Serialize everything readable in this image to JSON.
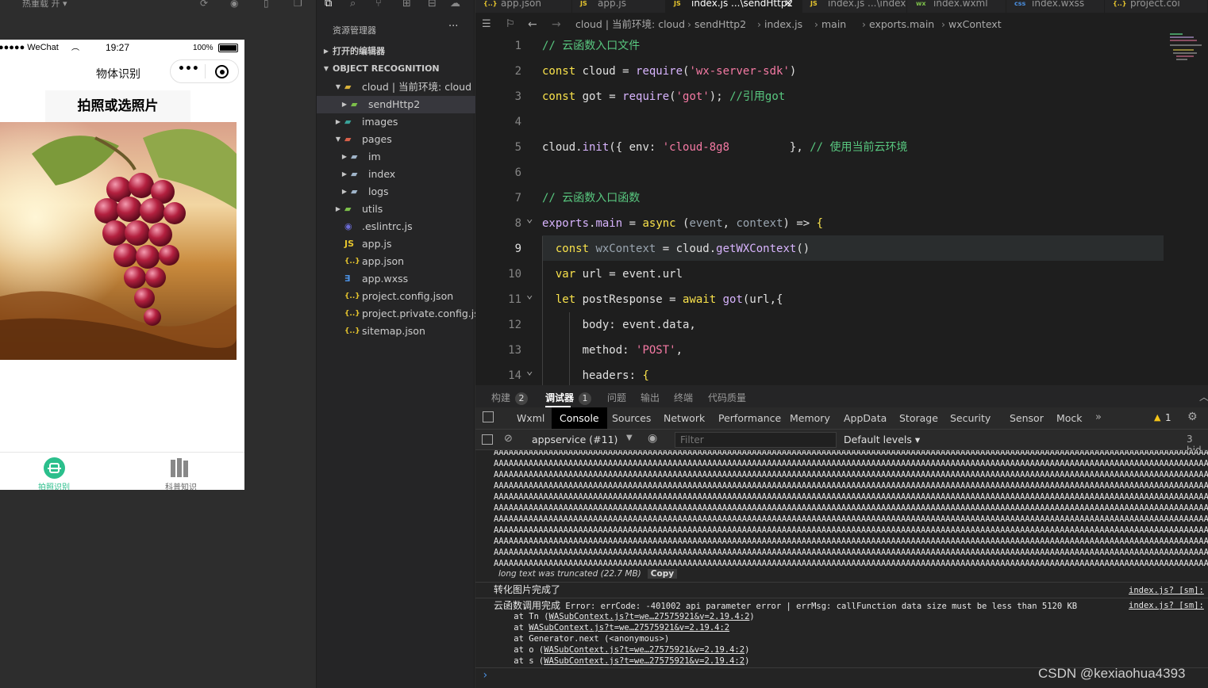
{
  "sim_topbar": {
    "label": "热重载 开 ▾"
  },
  "phone": {
    "status": {
      "carrier": "●●●●● WeChat",
      "time": "19:27",
      "battery": "100%"
    },
    "nav_title": "物体识别",
    "capsule_more": "•••",
    "photo_button": "拍照或选照片",
    "tabbar": [
      {
        "label": "拍照识别",
        "active": true
      },
      {
        "label": "科普知识",
        "active": false
      }
    ],
    "accent_color": "#2bbf8c"
  },
  "explorer": {
    "title": "资源管理器",
    "more": "···",
    "open_editors": "打开的编辑器",
    "project": "OBJECT RECOGNITION",
    "tree": [
      {
        "label": "cloud | 当前环境: cloud",
        "level": 1,
        "expanded": true,
        "type": "folder-cloud"
      },
      {
        "label": "sendHttp2",
        "level": 2,
        "expanded": false,
        "type": "folder-green",
        "selected": true
      },
      {
        "label": "images",
        "level": 1,
        "expanded": false,
        "type": "folder-teal"
      },
      {
        "label": "pages",
        "level": 1,
        "expanded": true,
        "type": "folder-red"
      },
      {
        "label": "im",
        "level": 2,
        "expanded": false,
        "type": "folder-plain"
      },
      {
        "label": "index",
        "level": 2,
        "expanded": false,
        "type": "folder-plain"
      },
      {
        "label": "logs",
        "level": 2,
        "expanded": false,
        "type": "folder-plain"
      },
      {
        "label": "utils",
        "level": 1,
        "expanded": false,
        "type": "folder-green"
      },
      {
        "label": ".eslintrc.js",
        "level": 1,
        "type": "file-eslint"
      },
      {
        "label": "app.js",
        "level": 1,
        "type": "file-js"
      },
      {
        "label": "app.json",
        "level": 1,
        "type": "file-json"
      },
      {
        "label": "app.wxss",
        "level": 1,
        "type": "file-css"
      },
      {
        "label": "project.config.json",
        "level": 1,
        "type": "file-json"
      },
      {
        "label": "project.private.config.js...",
        "level": 1,
        "type": "file-json"
      },
      {
        "label": "sitemap.json",
        "level": 1,
        "type": "file-json"
      }
    ]
  },
  "tabs": [
    {
      "label": "app.json",
      "icon": "{..}",
      "active": false
    },
    {
      "label": "app.js",
      "icon": "JS",
      "active": false
    },
    {
      "label": "index.js ...\\sendHttp2",
      "icon": "JS",
      "active": true,
      "close": "✕"
    },
    {
      "label": "index.js ...\\index",
      "icon": "JS",
      "active": false
    },
    {
      "label": "index.wxml",
      "icon": "wx",
      "active": false
    },
    {
      "label": "index.wxss",
      "icon": "css",
      "active": false
    },
    {
      "label": "project.coi",
      "icon": "{..}",
      "active": false
    }
  ],
  "breadcrumb": [
    "cloud | 当前环境: cloud",
    "sendHttp2",
    "index.js",
    "main",
    "exports.main",
    "wxContext"
  ],
  "code_lines": [
    {
      "n": "1",
      "parts": [
        [
          "cmt",
          "// 云函数入口文件"
        ]
      ]
    },
    {
      "n": "2",
      "parts": [
        [
          "kw",
          "const "
        ],
        [
          "plain",
          "cloud "
        ],
        [
          "plain",
          "= "
        ],
        [
          "fn",
          "require"
        ],
        [
          "plain",
          "("
        ],
        [
          "str",
          "'wx-server-sdk'"
        ],
        [
          "plain",
          ")"
        ]
      ]
    },
    {
      "n": "3",
      "parts": [
        [
          "kw",
          "const "
        ],
        [
          "plain",
          "got "
        ],
        [
          "plain",
          "= "
        ],
        [
          "fn",
          "require"
        ],
        [
          "plain",
          "("
        ],
        [
          "str",
          "'got'"
        ],
        [
          "plain",
          "); "
        ],
        [
          "cmt",
          "//引用got"
        ]
      ]
    },
    {
      "n": "4",
      "parts": []
    },
    {
      "n": "5",
      "parts": [
        [
          "plain",
          "cloud."
        ],
        [
          "fn",
          "init"
        ],
        [
          "plain",
          "({ env: "
        ],
        [
          "str",
          "'cloud-8g8"
        ],
        [
          "plain",
          "         "
        ],
        [
          "plain",
          "}, "
        ],
        [
          "cmt",
          "// 使用当前云环境"
        ]
      ]
    },
    {
      "n": "6",
      "parts": []
    },
    {
      "n": "7",
      "parts": [
        [
          "cmt",
          "// 云函数入口函数"
        ]
      ]
    },
    {
      "n": "8",
      "parts": [
        [
          "fn",
          "exports"
        ],
        [
          "plain",
          "."
        ],
        [
          "fn",
          "main"
        ],
        [
          "plain",
          " = "
        ],
        [
          "kw",
          "async "
        ],
        [
          "plain",
          "("
        ],
        [
          "dim",
          "event"
        ],
        [
          "plain",
          ", "
        ],
        [
          "dim",
          "context"
        ],
        [
          "plain",
          ") => "
        ],
        [
          "kw",
          "{"
        ]
      ]
    },
    {
      "n": "9",
      "parts": [
        [
          "plain",
          "  "
        ],
        [
          "kw",
          "const "
        ],
        [
          "dim",
          "wxContext"
        ],
        [
          "plain",
          " = cloud."
        ],
        [
          "fn",
          "getWXContext"
        ],
        [
          "plain",
          "()"
        ]
      ]
    },
    {
      "n": "10",
      "parts": [
        [
          "plain",
          "  "
        ],
        [
          "kw",
          "var "
        ],
        [
          "plain",
          "url = event.url"
        ]
      ]
    },
    {
      "n": "11",
      "parts": [
        [
          "plain",
          "  "
        ],
        [
          "kw",
          "let "
        ],
        [
          "plain",
          "postResponse = "
        ],
        [
          "kw",
          "await "
        ],
        [
          "fn",
          "got"
        ],
        [
          "plain",
          "(url,{"
        ]
      ]
    },
    {
      "n": "12",
      "parts": [
        [
          "plain",
          "      body: event.data,"
        ]
      ]
    },
    {
      "n": "13",
      "parts": [
        [
          "plain",
          "      method: "
        ],
        [
          "str",
          "'POST'"
        ],
        [
          "plain",
          ","
        ]
      ]
    },
    {
      "n": "14",
      "parts": [
        [
          "plain",
          "      headers: "
        ],
        [
          "kw",
          "{"
        ]
      ]
    }
  ],
  "panel_tabs": [
    {
      "label": "构建",
      "badge": "2"
    },
    {
      "label": "调试器",
      "badge": "1",
      "active": true
    },
    {
      "label": "问题"
    },
    {
      "label": "输出"
    },
    {
      "label": "终端"
    },
    {
      "label": "代码质量"
    }
  ],
  "devtools_tabs": [
    "Wxml",
    "Console",
    "Sources",
    "Network",
    "Performance",
    "Memory",
    "AppData",
    "Storage",
    "Security",
    "Sensor",
    "Mock"
  ],
  "devtools_more": "»",
  "warn_count": "1",
  "console_bar": {
    "context": "appservice (#11)",
    "filter_placeholder": "Filter",
    "levels": "Default levels ▾",
    "hidden": "3 hid"
  },
  "console": {
    "a_line": "AAAAAAAAAAAAAAAAAAAAAAAAAAAAAAAAAAAAAAAAAAAAAAAAAAAAAAAAAAAAAAAAAAAAAAAAAAAAAAAAAAAAAAAAAAAAAAAAAAAAAAAAAAAAAAAAAAAAAAAAAAAAAAAAAAAAAAAAAAAAAAAAAAAAAAAAAAAAAAAAAAAAAAAA",
    "a_last": "AAAAAAAAAAAAAAAAAAAAAAAAAAAAAAAAAAAAAAAAAAAAAAAAAAAAAAAAAAAAAAAAAAAAAAAAAAAAAAAAAAAAAAAAAAAAAAAAAAAAAAAAAAAAAAAAAAAAAAAAAAAAAAAAAAAAAAAAAAAAAAAAAAAAAAAAAAAAAAAAAAA",
    "truncated": "long text was truncated (22.7 MB)",
    "copy": "Copy",
    "msg1": "转化图片完成了",
    "src1": "index.js? [sm]:",
    "msg2_prefix": "云函数调用完成",
    "msg2": " Error: errCode: -401002 api parameter error | errMsg: callFunction data size must be less than 5120 KB",
    "src2": "index.js? [sm]:",
    "stack": [
      {
        "pre": "    at Tn (",
        "link": "WASubContext.js?t=we…27575921&v=2.19.4:2",
        "post": ")"
      },
      {
        "pre": "    at ",
        "link": "WASubContext.js?t=we…27575921&v=2.19.4:2",
        "post": ""
      },
      {
        "pre": "    at Generator.next (<anonymous>)",
        "link": "",
        "post": ""
      },
      {
        "pre": "    at o (",
        "link": "WASubContext.js?t=we…27575921&v=2.19.4:2",
        "post": ")"
      },
      {
        "pre": "    at s (",
        "link": "WASubContext.js?t=we…27575921&v=2.19.4:2",
        "post": ")"
      }
    ],
    "prompt": "›"
  },
  "watermark": "CSDN @kexiaohua4393"
}
